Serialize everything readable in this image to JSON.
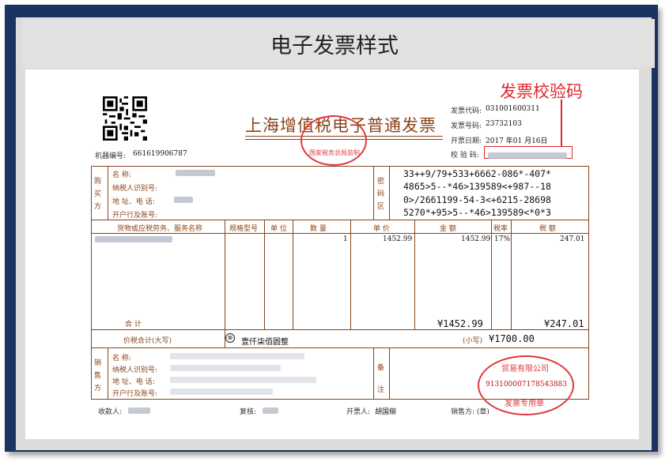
{
  "page": {
    "title": "电子发票样式",
    "annotation_label": "发票校验码"
  },
  "invoice": {
    "title": "上海增值税电子普通发票",
    "machine_label": "机器编号:",
    "machine_no": "661619906787",
    "tax_seal_text": "国家税务总局监制",
    "meta": {
      "code_label": "发票代码:",
      "code": "031001600311",
      "number_label": "发票号码:",
      "number": "23732103",
      "date_label": "开票日期:",
      "date": "2017 年01 月16日",
      "verify_label": "校 验 码:"
    },
    "buyer": {
      "section": "购买方",
      "name_label": "名 称:",
      "taxid_label": "纳税人识别号:",
      "addr_label": "地 址、电 话:",
      "bank_label": "开户行及账号:"
    },
    "cipher_section": "密码区",
    "cipher": [
      "33++9/79+533+6662-086*-407*",
      "4865>5--*46>139589<+987--18",
      "0>/2661199-54-3<+6215-28698",
      "5270*+95>5--*46>139589<*0*3"
    ],
    "columns": {
      "item": "货物或应税劳务、服务名称",
      "spec": "规格型号",
      "unit": "单 位",
      "qty": "数 量",
      "price": "单 价",
      "amount": "金 额",
      "rate": "税率",
      "tax": "税 额"
    },
    "line": {
      "qty": "1",
      "price": "1452.99",
      "amount": "1452.99",
      "rate": "17%",
      "tax": "247.01"
    },
    "subtotal": {
      "label": "合 计",
      "amount": "¥1452.99",
      "tax": "¥247.01"
    },
    "total": {
      "label": "价税合计(大写)",
      "words_icon": "⊗",
      "words": "壹仟柒佰圆整",
      "small_label": "(小写)",
      "small": "¥1700.00"
    },
    "seller": {
      "section": "销售方",
      "name_label": "名 称:",
      "taxid_label": "纳税人识别号:",
      "addr_label": "地 址、电 话:",
      "bank_label": "开户行及账号:"
    },
    "remarks_section": "备注",
    "seller_seal": {
      "code": "913100007178543883",
      "top": "贸易有限公司",
      "bottom": "发票专用章"
    },
    "footer": {
      "payee_label": "收款人:",
      "reviewer_label": "复核:",
      "issuer_label": "开票人:",
      "issuer": "胡国俪",
      "seller_label": "销售方: (章)"
    }
  },
  "colors": {
    "frame": "#1a3361",
    "invoice_brown": "#8a4418",
    "seal_red": "#e0383e"
  }
}
